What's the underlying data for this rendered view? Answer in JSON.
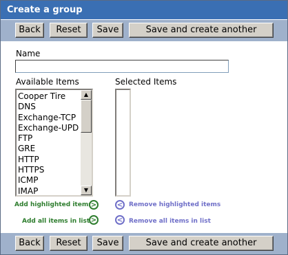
{
  "title": "Create a group",
  "toolbar": {
    "back_label": "Back",
    "reset_label": "Reset",
    "save_label": "Save",
    "save_another_label": "Save and create another"
  },
  "form": {
    "name_label": "Name",
    "name_value": "",
    "available_label": "Available Items",
    "selected_label": "Selected Items",
    "available_items": [
      "Cooper Tire",
      "DNS",
      "Exchange-TCP",
      "Exchange-UPD",
      "FTP",
      "GRE",
      "HTTP",
      "HTTPS",
      "ICMP",
      "IMAP"
    ],
    "selected_items": []
  },
  "actions": {
    "add_highlighted": "Add highlighted items",
    "add_all": "Add all items in list",
    "remove_highlighted": "Remove highlighted items",
    "remove_all": "Remove all items in list"
  },
  "icons": {
    "add": "arrow-right-circle-icon",
    "remove": "arrow-left-circle-icon",
    "scroll_up": "triangle-up-icon",
    "scroll_down": "triangle-down-icon"
  },
  "colors": {
    "titlebar": "#3a6fb3",
    "toolbar": "#9fb1cb",
    "add_action": "#2e7d2e",
    "remove_action": "#6f6fc8"
  }
}
